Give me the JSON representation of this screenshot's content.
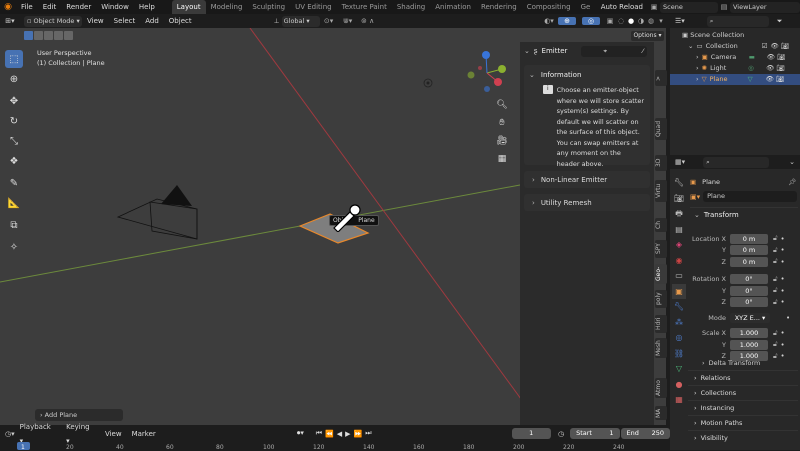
{
  "topbar": {
    "menus": [
      "File",
      "Edit",
      "Render",
      "Window",
      "Help"
    ],
    "workspaces": [
      "Layout",
      "Modeling",
      "Sculpting",
      "UV Editing",
      "Texture Paint",
      "Shading",
      "Animation",
      "Rendering",
      "Compositing",
      "Ge"
    ],
    "active_workspace": "Layout",
    "auto_reload": "Auto Reload",
    "scene": "Scene",
    "view_layer": "ViewLayer"
  },
  "viewport_header": {
    "mode": "Object Mode",
    "menus": [
      "View",
      "Select",
      "Add",
      "Object"
    ],
    "transform_orientation": "Global",
    "options": "Options"
  },
  "viewport": {
    "perspective": "User Perspective",
    "collection_info": "(1) Collection | Plane",
    "tooltip": "Plane",
    "tooltip_prefix": "Obj",
    "last_op": "Add Plane"
  },
  "npanel": {
    "header": "Emitter",
    "info_title": "Information",
    "info_text": "Choose an emitter-object where we will store scatter system(s) settings. By default we will scatter on the surface of this object. You can swap emitters at any moment on the header above.",
    "sections": [
      "Non-Linear Emitter",
      "Utility Remesh"
    ],
    "tabs": [
      "Quad",
      "3D",
      "Virtu",
      "Ch",
      "SPY",
      "Geo-",
      "poly",
      "Hdri",
      "Mesh",
      "Atmo",
      "MA"
    ]
  },
  "outliner": {
    "root": "Scene Collection",
    "collection": "Collection",
    "items": [
      "Camera",
      "Light",
      "Plane"
    ]
  },
  "properties": {
    "object_name": "Plane",
    "data_name": "Plane",
    "transform_title": "Transform",
    "location": {
      "label": "Location X",
      "x": "0 m",
      "y": "0 m",
      "z": "0 m"
    },
    "rotation": {
      "label": "Rotation X",
      "x": "0°",
      "y": "0°",
      "z": "0°"
    },
    "mode_label": "Mode",
    "mode_value": "XYZ E...",
    "scale": {
      "label": "Scale X",
      "x": "1.000",
      "y": "1.000",
      "z": "1.000"
    },
    "axis_y": "Y",
    "axis_z": "Z",
    "delta_transform": "Delta Transform",
    "sections": [
      "Relations",
      "Collections",
      "Instancing",
      "Motion Paths",
      "Visibility"
    ]
  },
  "timeline": {
    "menus": [
      "Playback",
      "Keying",
      "View",
      "Marker"
    ],
    "current_frame": "1",
    "start_label": "Start",
    "start": "1",
    "end_label": "End",
    "end": "250",
    "ticks": [
      "1",
      "20",
      "40",
      "60",
      "80",
      "100",
      "120",
      "140",
      "160",
      "180",
      "200",
      "220",
      "240"
    ]
  }
}
